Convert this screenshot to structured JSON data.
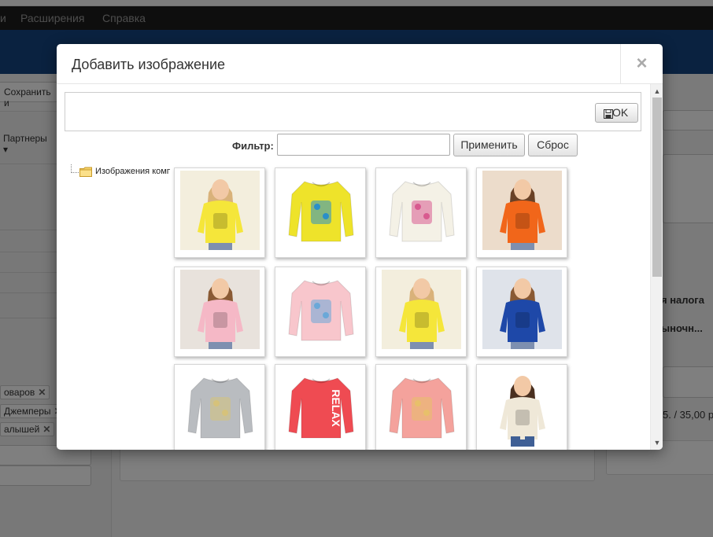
{
  "background": {
    "menu": [
      "Расширения",
      "Справка"
    ],
    "menu_fragment": "и",
    "toolbar_save": "Сохранить и",
    "partners_label": "Партнеры",
    "tags": [
      "оваров",
      "Джемперы",
      "алышей"
    ],
    "right_text_1": "я налога",
    "right_text_2": "ыночн...",
    "right_text_3": "5. / 35,00 р"
  },
  "modal": {
    "title": "Добавить изображение",
    "close_label": "×",
    "ok_label": "OK",
    "filter_label": "Фильтр:",
    "filter_value": "",
    "apply_label": "Применить",
    "reset_label": "Сброс",
    "tree_root_label": "Изображения комп"
  },
  "icons": {
    "close": "close-icon",
    "ok": "floppy-disk-icon",
    "folder": "folder-icon",
    "scroll_up": "chevron-up-icon",
    "scroll_down": "chevron-down-icon"
  },
  "colors": {
    "header_blue": "#154580",
    "menubar": "#1d1d1d",
    "overlay": "rgba(0,0,0,0.5)"
  },
  "thumbnails": [
    {
      "kind": "model",
      "shirt": "#f5e63a",
      "bg": "#f3eedd",
      "hair": "#d9b27a"
    },
    {
      "kind": "product",
      "shirt": "#eee32a",
      "bg": "#ffffff",
      "print": "#2a8fc9"
    },
    {
      "kind": "product",
      "shirt": "#f4f1e6",
      "bg": "#ffffff",
      "print": "#d85a8f"
    },
    {
      "kind": "model",
      "shirt": "#f1661a",
      "bg": "#ecdccb",
      "hair": "#6a4126"
    },
    {
      "kind": "model",
      "shirt": "#f5b8c6",
      "bg": "#e8e2dc",
      "hair": "#8a5a34"
    },
    {
      "kind": "product",
      "shirt": "#f8c6cc",
      "bg": "#ffffff",
      "print": "#6aa8d8"
    },
    {
      "kind": "model",
      "shirt": "#f5e63a",
      "bg": "#f3eedd",
      "hair": "#d9b27a"
    },
    {
      "kind": "model",
      "shirt": "#1e48a8",
      "bg": "#dfe3ea",
      "hair": "#8a5a34"
    },
    {
      "kind": "product",
      "shirt": "#b9bcc0",
      "bg": "#ffffff",
      "print": "#d6c27a"
    },
    {
      "kind": "product",
      "shirt": "#ef4b52",
      "bg": "#ffffff",
      "print": "#ffffff",
      "text": "RELAX"
    },
    {
      "kind": "product",
      "shirt": "#f4a29c",
      "bg": "#ffffff",
      "print": "#e8c06a"
    },
    {
      "kind": "model",
      "shirt": "#efe8d8",
      "bg": "#ffffff",
      "hair": "#4a3020",
      "jeans": true
    }
  ]
}
